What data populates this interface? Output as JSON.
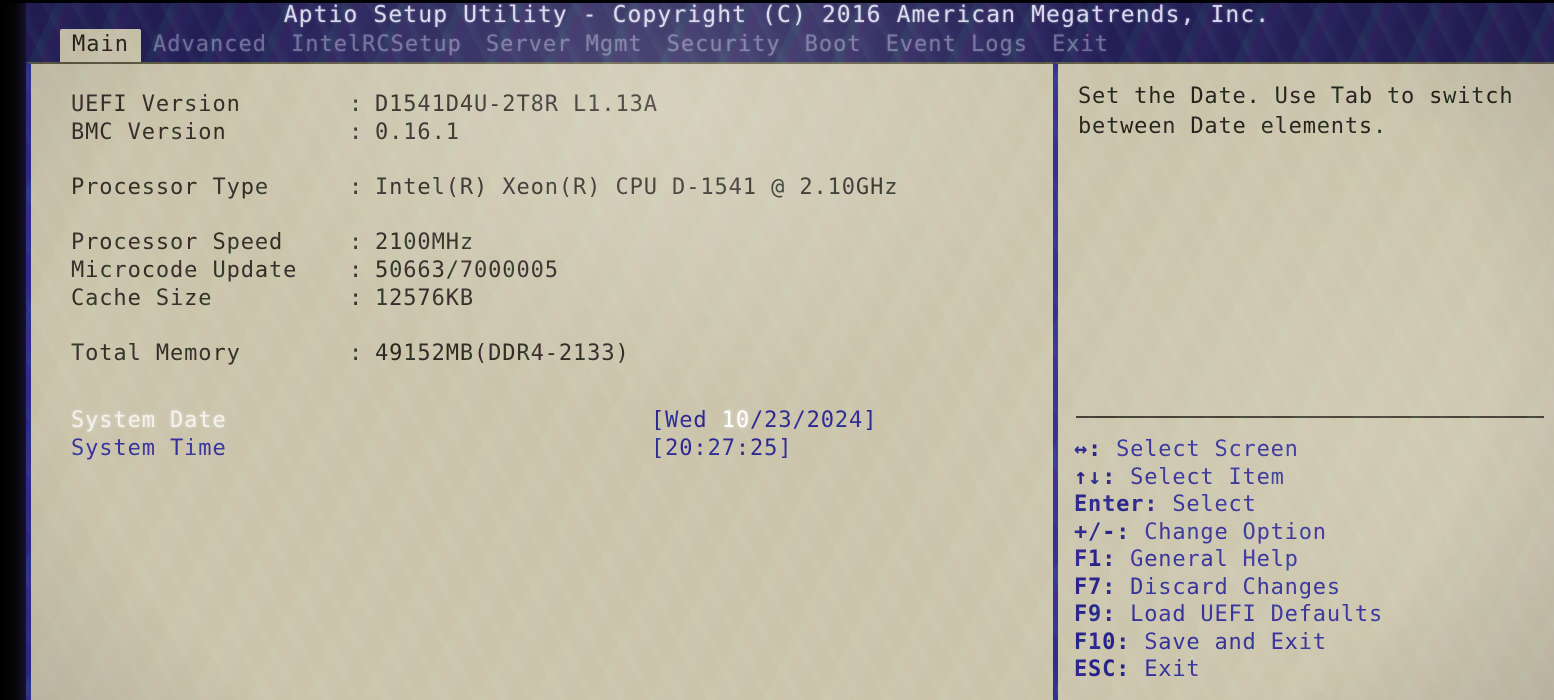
{
  "window": {
    "title": "Aptio Setup Utility - Copyright (C) 2016 American Megatrends, Inc."
  },
  "menu": {
    "tabs": [
      {
        "label": "Main",
        "active": true
      },
      {
        "label": "Advanced",
        "active": false
      },
      {
        "label": "IntelRCSetup",
        "active": false
      },
      {
        "label": "Server Mgmt",
        "active": false
      },
      {
        "label": "Security",
        "active": false
      },
      {
        "label": "Boot",
        "active": false
      },
      {
        "label": "Event Logs",
        "active": false
      },
      {
        "label": "Exit",
        "active": false
      }
    ]
  },
  "main": {
    "info_rows": [
      {
        "label": "UEFI Version",
        "separator": ":",
        "value": "D1541D4U-2T8R L1.13A",
        "gap_before": false
      },
      {
        "label": "BMC Version",
        "separator": ":",
        "value": "0.16.1",
        "gap_before": false
      },
      {
        "label": "Processor Type",
        "separator": ":",
        "value": "Intel(R) Xeon(R) CPU D-1541 @ 2.10GHz",
        "gap_before": true
      },
      {
        "label": "Processor Speed",
        "separator": ":",
        "value": "2100MHz",
        "gap_before": true
      },
      {
        "label": "Microcode Update",
        "separator": ":",
        "value": "50663/7000005",
        "gap_before": false
      },
      {
        "label": "Cache Size",
        "separator": ":",
        "value": "12576KB",
        "gap_before": false
      },
      {
        "label": "Total Memory",
        "separator": ":",
        "value": "49152MB(DDR4-2133)",
        "gap_before": true
      }
    ],
    "settings": [
      {
        "label": "System Date",
        "value_prefix": "[Wed ",
        "value_highlight": "10",
        "value_suffix": "/23/2024]",
        "full_value": "[Wed 10/23/2024]",
        "selected": true
      },
      {
        "label": "System Time",
        "value_prefix": "",
        "value_highlight": "",
        "value_suffix": "",
        "full_value": "[20:27:25]",
        "selected": false
      }
    ]
  },
  "help": {
    "description": "Set the Date. Use Tab to switch between Date elements.",
    "legend": [
      {
        "keys": "↔:",
        "action": " Select Screen"
      },
      {
        "keys": "↑↓:",
        "action": " Select Item"
      },
      {
        "keys": "Enter:",
        "action": " Select"
      },
      {
        "keys": "+/-:",
        "action": " Change Option"
      },
      {
        "keys": "F1:",
        "action": " General Help"
      },
      {
        "keys": "F7:",
        "action": " Discard Changes"
      },
      {
        "keys": "F9:",
        "action": " Load UEFI Defaults"
      },
      {
        "keys": "F10:",
        "action": " Save and Exit"
      },
      {
        "keys": "ESC:",
        "action": " Exit"
      }
    ]
  },
  "colors": {
    "header_band": "#241f56",
    "panel_background": "#cbc4ab",
    "active_tab_background": "#cdc6ad",
    "panel_border": "#2f2a8e",
    "setting_text": "#36309a",
    "selected_text": "#ffffff",
    "info_text": "#322c24"
  }
}
